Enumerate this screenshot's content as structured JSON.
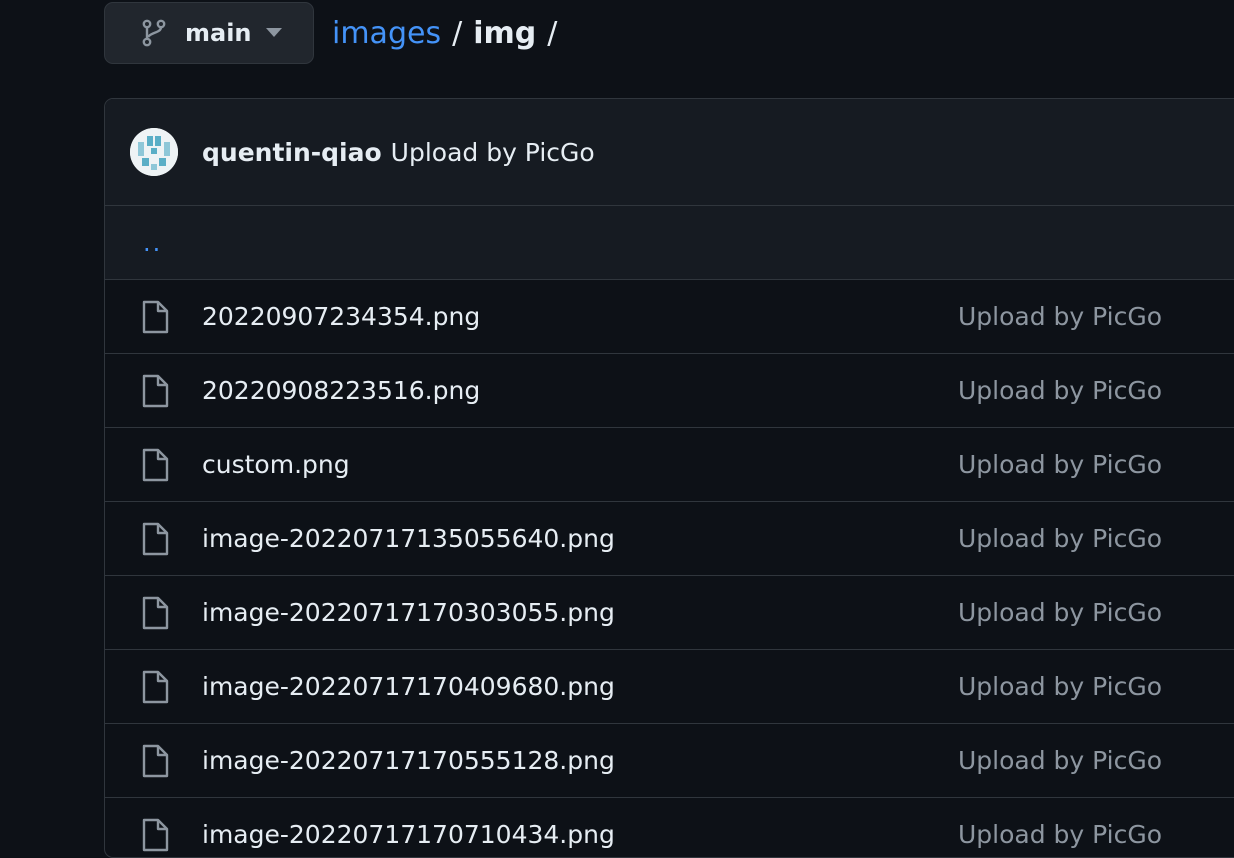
{
  "branch": {
    "icon": "git-branch-icon",
    "name": "main",
    "caret_icon": "triangle-down-icon"
  },
  "breadcrumb": {
    "repo": "images",
    "separator": "/",
    "current": "img",
    "trailing": "/"
  },
  "latest_commit": {
    "avatar": "avatar",
    "author": "quentin-qiao",
    "message": "Upload by PicGo"
  },
  "parent_dir": {
    "label": ".."
  },
  "files": [
    {
      "name": "20220907234354.png",
      "commit": "Upload by PicGo",
      "icon": "file-icon"
    },
    {
      "name": "20220908223516.png",
      "commit": "Upload by PicGo",
      "icon": "file-icon"
    },
    {
      "name": "custom.png",
      "commit": "Upload by PicGo",
      "icon": "file-icon"
    },
    {
      "name": "image-20220717135055640.png",
      "commit": "Upload by PicGo",
      "icon": "file-icon"
    },
    {
      "name": "image-20220717170303055.png",
      "commit": "Upload by PicGo",
      "icon": "file-icon"
    },
    {
      "name": "image-20220717170409680.png",
      "commit": "Upload by PicGo",
      "icon": "file-icon"
    },
    {
      "name": "image-20220717170555128.png",
      "commit": "Upload by PicGo",
      "icon": "file-icon"
    },
    {
      "name": "image-20220717170710434.png",
      "commit": "Upload by PicGo",
      "icon": "file-icon"
    }
  ],
  "colors": {
    "background": "#0d1117",
    "header_bg": "#161b22",
    "border": "#30363d",
    "link": "#4493f8",
    "text": "#e6edf3",
    "muted": "#8d96a0"
  }
}
